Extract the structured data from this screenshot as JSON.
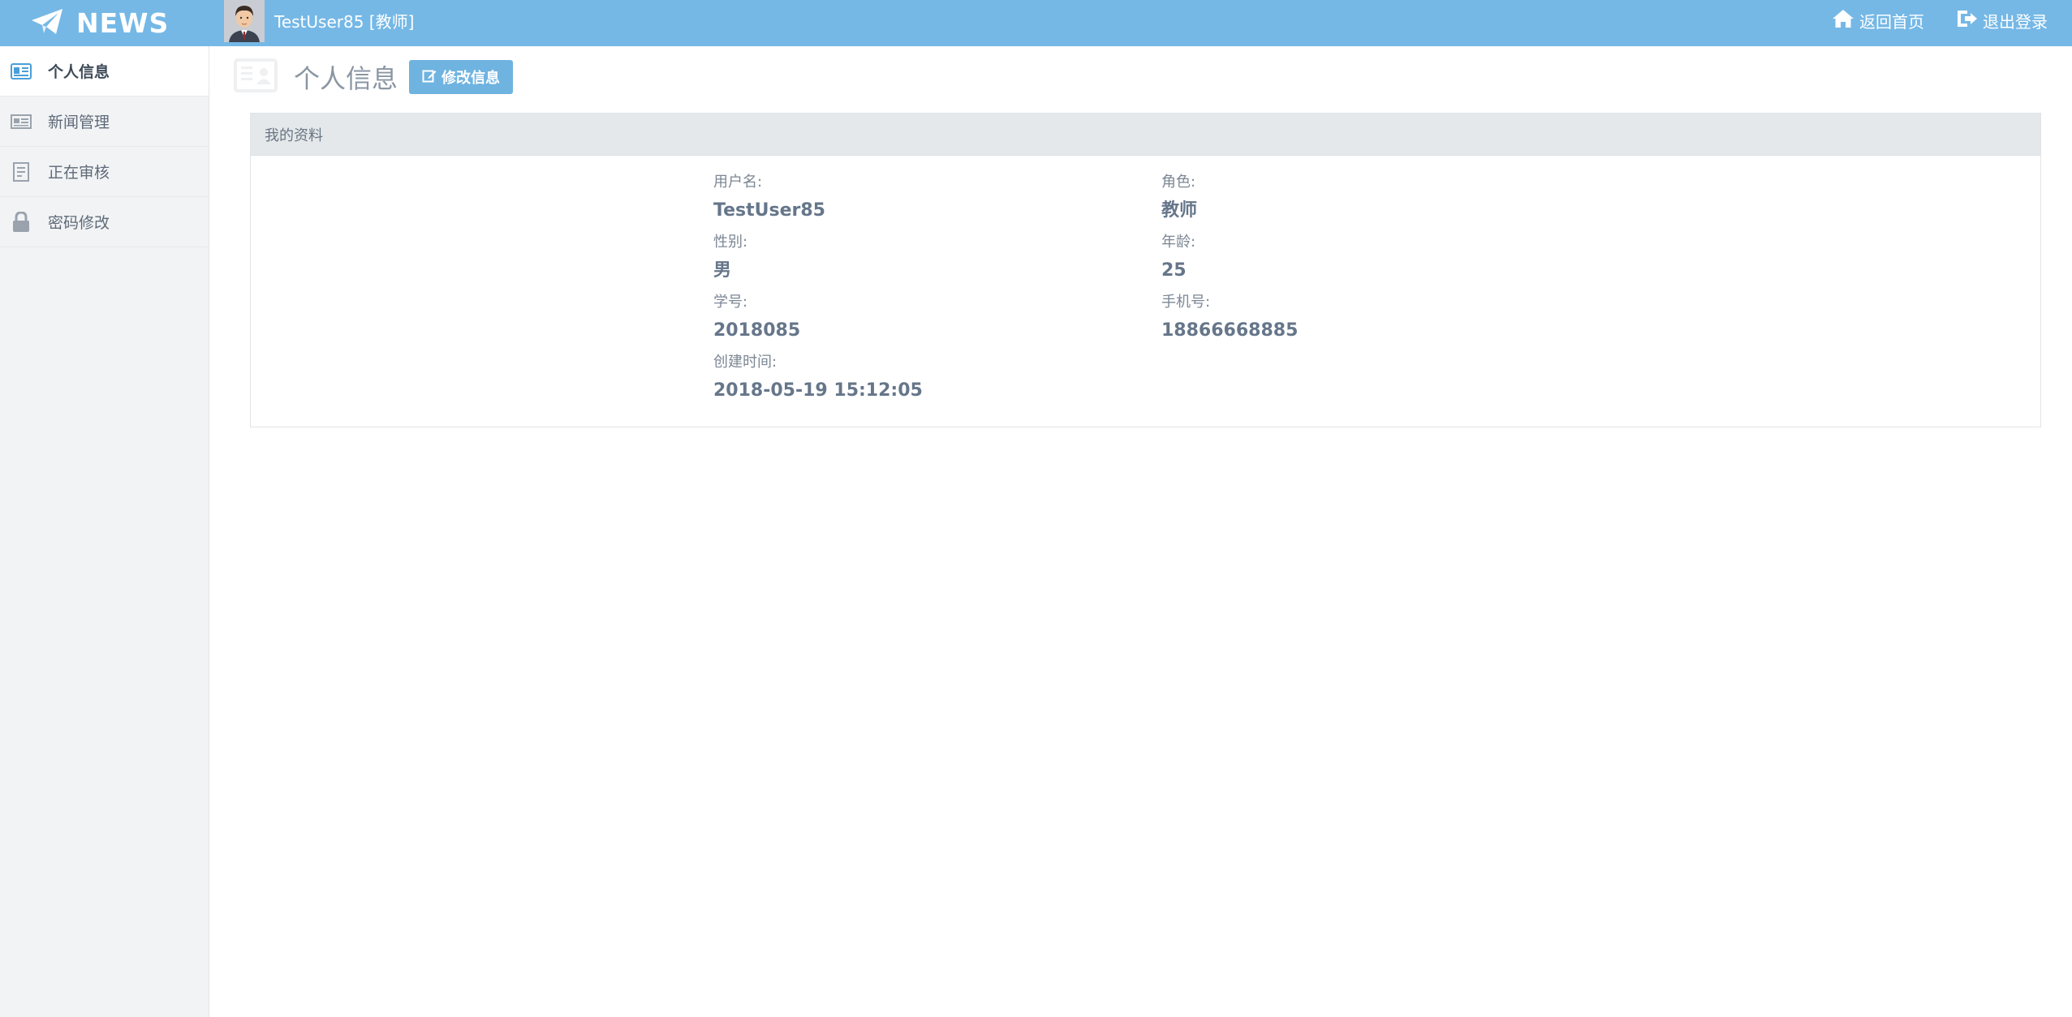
{
  "topbar": {
    "brand": "NEWS",
    "user_label": "TestUser85 [教师]",
    "home_link": "返回首页",
    "logout_link": "退出登录"
  },
  "sidebar": {
    "items": [
      {
        "label": "个人信息",
        "icon": "id-card-icon"
      },
      {
        "label": "新闻管理",
        "icon": "newspaper-icon"
      },
      {
        "label": "正在审核",
        "icon": "document-icon"
      },
      {
        "label": "密码修改",
        "icon": "lock-icon"
      }
    ]
  },
  "main": {
    "title": "个人信息",
    "edit_button": "修改信息"
  },
  "panel": {
    "heading": "我的资料",
    "fields": {
      "username": {
        "label": "用户名:",
        "value": "TestUser85"
      },
      "role": {
        "label": "角色:",
        "value": "教师"
      },
      "gender": {
        "label": "性别:",
        "value": "男"
      },
      "age": {
        "label": "年龄:",
        "value": "25"
      },
      "student_id": {
        "label": "学号:",
        "value": "2018085"
      },
      "phone": {
        "label": "手机号:",
        "value": "18866668885"
      },
      "created": {
        "label": "创建时间:",
        "value": "2018-05-19 15:12:05"
      }
    }
  },
  "colors": {
    "topbar": "#75b8e6",
    "button": "#6fb3e0",
    "sidebar": "#f2f3f5",
    "panel_header": "#e4e8eb"
  }
}
